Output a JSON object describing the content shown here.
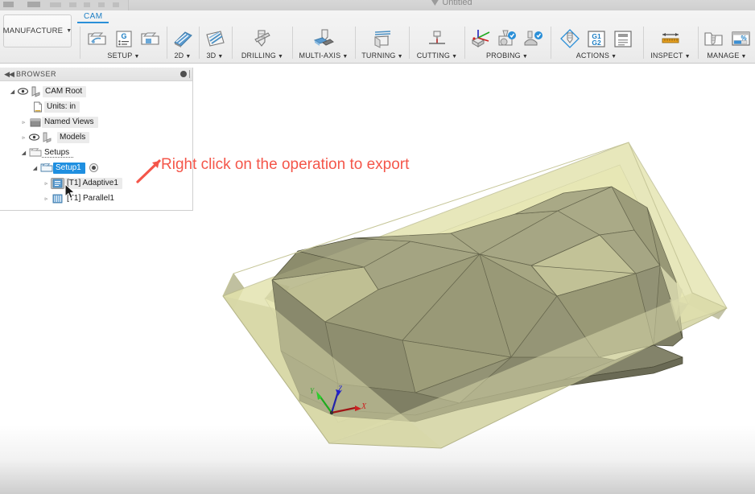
{
  "window": {
    "doc_title": "Untitled",
    "doc_icon": "fusion-doc-icon"
  },
  "ribbon": {
    "workspace_button": "MANUFACTURE",
    "workspace_caret": "▼",
    "tabs": [
      {
        "label": "CAM",
        "active": true
      }
    ],
    "groups": [
      {
        "label": "SETUP",
        "caret": "▼",
        "icons": [
          "new-setup-icon",
          "gcode-list-icon",
          "new-folder-icon"
        ]
      },
      {
        "label": "2D",
        "caret": "▼",
        "icons": [
          "2d-toolpath-icon"
        ]
      },
      {
        "label": "3D",
        "caret": "▼",
        "icons": [
          "3d-toolpath-icon"
        ]
      },
      {
        "label": "DRILLING",
        "caret": "▼",
        "icons": [
          "drilling-icon"
        ]
      },
      {
        "label": "MULTI-AXIS",
        "caret": "▼",
        "icons": [
          "multi-axis-icon"
        ]
      },
      {
        "label": "TURNING",
        "caret": "▼",
        "icons": [
          "turning-icon"
        ]
      },
      {
        "label": "CUTTING",
        "caret": "▼",
        "icons": [
          "cutting-icon"
        ]
      },
      {
        "label": "PROBING",
        "caret": "▼",
        "icons": [
          "probe-wcs-icon",
          "probe-geometry-icon",
          "probe-surface-icon"
        ]
      },
      {
        "label": "ACTIONS",
        "caret": "▼",
        "icons": [
          "simulate-icon",
          "post-process-g1g2-icon",
          "setup-sheet-icon"
        ]
      },
      {
        "label": "INSPECT",
        "caret": "▼",
        "icons": [
          "measure-icon"
        ]
      },
      {
        "label": "MANAGE",
        "caret": "▼",
        "icons": [
          "tool-library-icon",
          "machining-time-icon"
        ]
      }
    ]
  },
  "browser": {
    "title": "BROWSER",
    "collapse_icon": "collapse-left-icon",
    "pin_icon": "pin-icon",
    "tree": [
      {
        "label": "CAM Root",
        "indent": 0,
        "twisty": "◢",
        "eye": true,
        "icon": "cam-root-icon",
        "state": "hover"
      },
      {
        "label": "Units: in",
        "indent": 1,
        "twisty": "",
        "eye": false,
        "icon": "units-doc-icon",
        "state": "hover"
      },
      {
        "label": "Named Views",
        "indent": 1,
        "twisty": "▹",
        "eye": false,
        "icon": "named-views-folder-icon",
        "state": "hover"
      },
      {
        "label": "Models",
        "indent": 1,
        "twisty": "▹",
        "eye": true,
        "icon": "models-icon",
        "state": "hover"
      },
      {
        "label": "Setups",
        "indent": 1,
        "twisty": "◢",
        "eye": false,
        "icon": "setups-folder-icon",
        "state": "dashed"
      },
      {
        "label": "Setup1",
        "indent": 2,
        "twisty": "◢",
        "eye": false,
        "icon": "setup-folder-icon",
        "state": "selected",
        "radio": true
      },
      {
        "label": "[T1] Adaptive1",
        "indent": 3,
        "twisty": "▹",
        "eye": false,
        "icon": "adaptive-clearing-icon",
        "state": "op-hover"
      },
      {
        "label": "[T1] Parallel1",
        "indent": 3,
        "twisty": "▹",
        "eye": false,
        "icon": "parallel-toolpath-icon",
        "state": "none"
      }
    ]
  },
  "annotation": {
    "text": "Right click on the operation to export",
    "color": "#f4564a",
    "arrow_icon": "annotation-arrow-icon"
  },
  "viewport": {
    "cursor_icon": "mouse-pointer-icon",
    "stock_color": "#e4e4ac",
    "model_color": "#8f8f6b",
    "axes": [
      {
        "label": "X",
        "color": "#cc2222"
      },
      {
        "label": "Y",
        "color": "#1faa1f"
      },
      {
        "label": "Z",
        "color": "#2222cc"
      }
    ]
  }
}
